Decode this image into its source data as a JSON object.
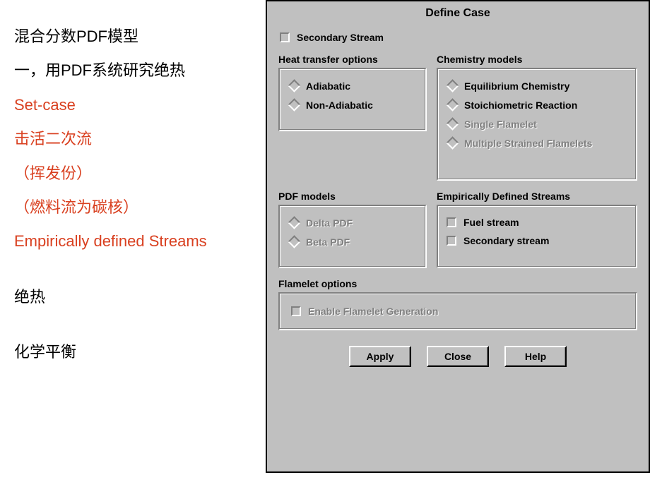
{
  "left_panel": {
    "line1": "混合分数PDF模型",
    "line2": "一，用PDF系统研究绝热",
    "line3": "Set-case",
    "line4": "击活二次流",
    "line5": "（挥发份）",
    "line6": "（燃料流为碳核）",
    "line7": "Empirically defined Streams",
    "line8": "绝热",
    "line9": "化学平衡"
  },
  "dialog": {
    "title": "Define Case",
    "secondary_stream": "Secondary Stream",
    "heat_transfer_label": "Heat transfer options",
    "chemistry_label": "Chemistry models",
    "heat": {
      "adiabatic": "Adiabatic",
      "non_adiabatic": "Non-Adiabatic"
    },
    "chem": {
      "equilibrium": "Equilibrium Chemistry",
      "stoich": "Stoichiometric Reaction",
      "single_flamelet": "Single Flamelet",
      "multiple_flamelets": "Multiple Strained Flamelets"
    },
    "pdf_label": "PDF models",
    "pdf": {
      "delta": "Delta PDF",
      "beta": "Beta PDF"
    },
    "eds_label": "Empirically Defined Streams",
    "eds": {
      "fuel": "Fuel stream",
      "secondary": "Secondary stream"
    },
    "flamelet_label": "Flamelet options",
    "flamelet_enable": "Enable Flamelet Generation",
    "buttons": {
      "apply": "Apply",
      "close": "Close",
      "help": "Help"
    }
  }
}
